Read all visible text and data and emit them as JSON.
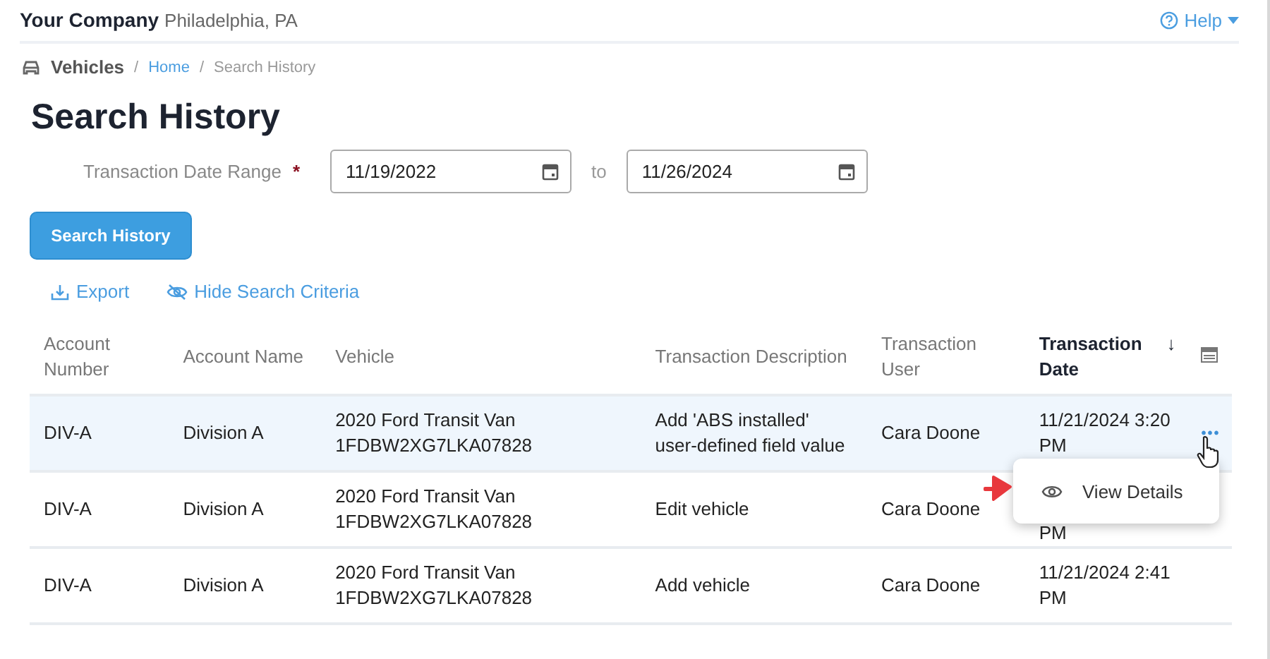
{
  "header": {
    "company": "Your Company",
    "location": "Philadelphia, PA",
    "help": "Help"
  },
  "breadcrumb_separator": "/",
  "breadcrumb": [
    {
      "label": "Vehicles",
      "kind": "section"
    },
    {
      "label": "Home",
      "kind": "link"
    },
    {
      "label": "Search History",
      "kind": "current"
    }
  ],
  "title": "Search History",
  "date_range": {
    "label": "Transaction Date Range",
    "required": "*",
    "from": "11/19/2022",
    "separator": "to",
    "to": "11/26/2024"
  },
  "search_button": "Search History",
  "actions": [
    {
      "label": "Export",
      "kind": "export"
    },
    {
      "label": "Hide Search Criteria",
      "kind": "hide"
    }
  ],
  "table": {
    "columns": [
      {
        "label": "Account Number",
        "sorted": false
      },
      {
        "label": "Account Name",
        "sorted": false
      },
      {
        "label": "Vehicle",
        "sorted": false
      },
      {
        "label": "Transaction Description",
        "sorted": false
      },
      {
        "label": "Transaction User",
        "sorted": false
      },
      {
        "label": "Transaction Date",
        "sorted": true,
        "sort_icon": "↓"
      }
    ],
    "rows": [
      {
        "selected": true,
        "cells": [
          "DIV-A",
          "Division A",
          "2020 Ford Transit Van 1FDBW2XG7LKA07828",
          "Add 'ABS installed' user-defined field value",
          "Cara Doone",
          "11/21/2024 3:20 PM"
        ],
        "covered": false
      },
      {
        "selected": false,
        "cells": [
          "DIV-A",
          "Division A",
          "2020 Ford Transit Van 1FDBW2XG7LKA07828",
          "Edit vehicle",
          "Cara Doone",
          "PM"
        ],
        "covered": true
      },
      {
        "selected": false,
        "cells": [
          "DIV-A",
          "Division A",
          "2020 Ford Transit Van 1FDBW2XG7LKA07828",
          "Add vehicle",
          "Cara Doone",
          "11/21/2024 2:41 PM"
        ],
        "covered": false
      }
    ]
  },
  "row_menu": {
    "more": "•••",
    "items": [
      "View Details"
    ]
  }
}
